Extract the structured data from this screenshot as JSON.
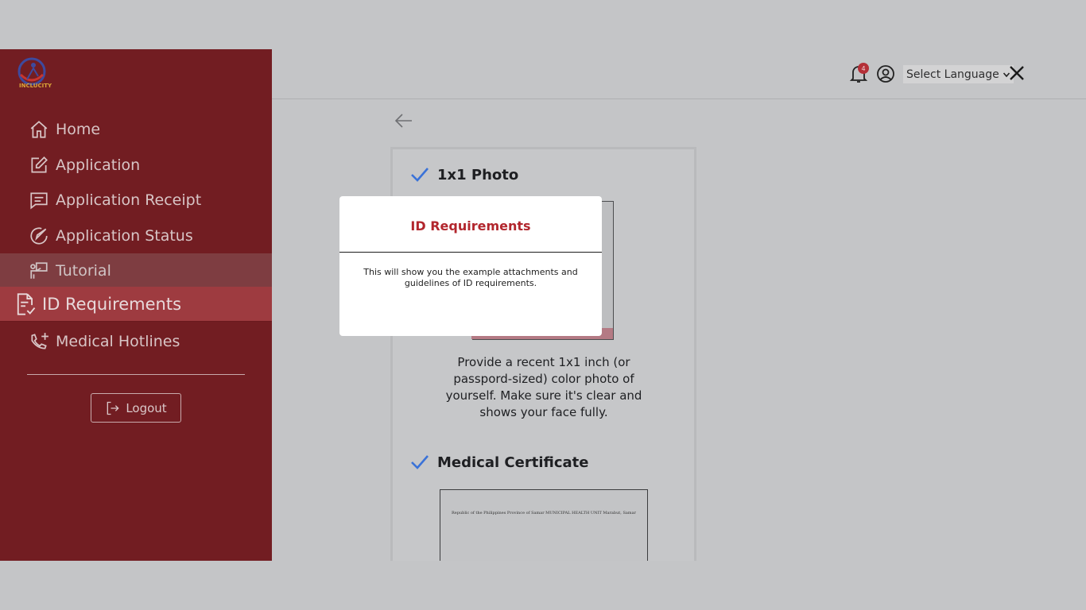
{
  "sidebar": {
    "logo_text": "INCLUCITY",
    "items": [
      {
        "label": "Home",
        "icon": "home-icon"
      },
      {
        "label": "Application",
        "icon": "edit-icon"
      },
      {
        "label": "Application Receipt",
        "icon": "receipt-icon"
      },
      {
        "label": "Application Status",
        "icon": "status-icon"
      },
      {
        "label": "Tutorial",
        "icon": "presenter-icon"
      },
      {
        "label": "ID Requirements",
        "icon": "document-check-icon"
      },
      {
        "label": "Medical Hotlines",
        "icon": "phone-plus-icon"
      }
    ],
    "active_item": "ID Requirements",
    "logout_label": "Logout"
  },
  "header": {
    "notification_count": "4",
    "language_label": "Select Language"
  },
  "main": {
    "requirements": [
      {
        "title": "1x1 Photo",
        "description": "Provide a recent 1x1 inch (or passpord-sized) color photo of yourself. Make sure it's clear and shows your face fully."
      },
      {
        "title": "Medical Certificate",
        "doc_text": "Republic of the Philippines Province of Samar MUNICIPAL HEALTH UNIT Marabut, Samar"
      }
    ]
  },
  "modal": {
    "title": "ID Requirements",
    "body": "This will show you the example attachments and guidelines   of ID requirements."
  },
  "colors": {
    "sidebar_bg": "#721d22",
    "active_bg": "#9e3b40",
    "modal_title": "#b2262d",
    "check": "#3a72d8",
    "overlay": "#c4c5c7"
  }
}
